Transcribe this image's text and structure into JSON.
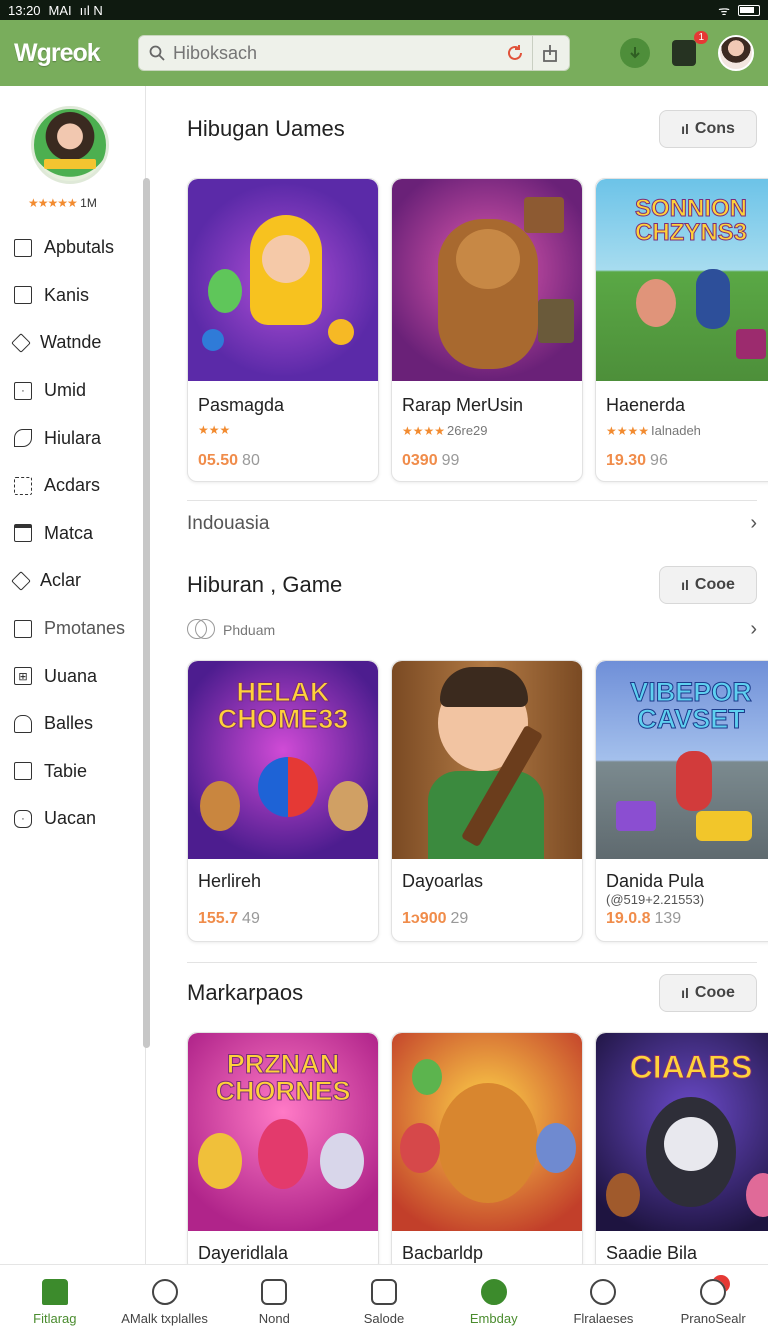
{
  "status_bar": {
    "time": "13:20",
    "carrier": "MAI",
    "extras": "ııl  N",
    "right": "ᯤ"
  },
  "header": {
    "logo": "Wgreok",
    "search_placeholder": "Hiboksach",
    "cart_badge": "1",
    "colors": {
      "bar": "#79ad5c",
      "accent": "#3c8b2c",
      "price": "#f08c4a"
    }
  },
  "sidebar": {
    "rating_stars": "★★★★★",
    "rating_count": "1M",
    "items": [
      {
        "label": "Apbutals",
        "icon": "square-icon"
      },
      {
        "label": "Kanis",
        "icon": "book-icon"
      },
      {
        "label": "Watnde",
        "icon": "tag-icon"
      },
      {
        "label": "Umid",
        "icon": "dot-square-icon"
      },
      {
        "label": "Hiulara",
        "icon": "fish-icon"
      },
      {
        "label": "Acdars",
        "icon": "puzzle-icon"
      },
      {
        "label": "Matca",
        "icon": "box-icon"
      },
      {
        "label": "Aclar",
        "icon": "diamond-icon"
      },
      {
        "label": "Pmotanes",
        "icon": "square-icon"
      },
      {
        "label": "Uuana",
        "icon": "grid-icon"
      },
      {
        "label": "Balles",
        "icon": "house-icon"
      },
      {
        "label": "Tabie",
        "icon": "square-icon"
      },
      {
        "label": "Uacan",
        "icon": "clock-icon"
      }
    ]
  },
  "sections": [
    {
      "title": "Hibugan Uames",
      "more": "Cons",
      "cards": [
        {
          "name": "Pasmagda",
          "stars": "★★★",
          "sub": "",
          "price": "05.50",
          "count": "80"
        },
        {
          "name": "Rarap MerUsin",
          "stars": "★★★★",
          "sub": "26re29",
          "price": "0390",
          "count": "99"
        },
        {
          "name": "Haenerda",
          "stars": "★★★★",
          "sub": "Ialnadeh",
          "price": "19.30",
          "count": "96",
          "thumb_text": "SONNION CHZYNS3"
        }
      ],
      "link": "Indouasia"
    },
    {
      "title": "Hiburan , Game",
      "more": "Cooe",
      "filter": "Phduam",
      "cards": [
        {
          "name": "Herlireh",
          "price": "155.7",
          "count": "49",
          "thumb_text": "HELAK CHOME33"
        },
        {
          "name": "Dayoarlas",
          "price": "1ɔ900",
          "count": "29"
        },
        {
          "name": "Danida Pula",
          "sub": "(@519+2.21553)",
          "price": "19.0.8",
          "count": "139",
          "thumb_text": "VIBEPOR CAVSET"
        }
      ]
    },
    {
      "title": "Markarpaos",
      "more": "Cooe",
      "cards": [
        {
          "name": "Dayeridlala",
          "thumb_text": "PRZNAN CHORNES"
        },
        {
          "name": "Bacbarldp",
          "thumb_text": ""
        },
        {
          "name": "Saadie Bila",
          "thumb_text": "CIAABS"
        }
      ]
    }
  ],
  "bottom_nav": [
    {
      "label": "Fitlarag",
      "icon": "home-icon"
    },
    {
      "label": "AMalk txplalles",
      "icon": "heart-chat-icon"
    },
    {
      "label": "Nond",
      "icon": "phone-icon"
    },
    {
      "label": "Salode",
      "icon": "dice-icon"
    },
    {
      "label": "Embday",
      "icon": "location-icon",
      "active": true
    },
    {
      "label": "Flralaeses",
      "icon": "person-icon"
    },
    {
      "label": "PranoSealr",
      "icon": "person-badge-icon"
    }
  ]
}
